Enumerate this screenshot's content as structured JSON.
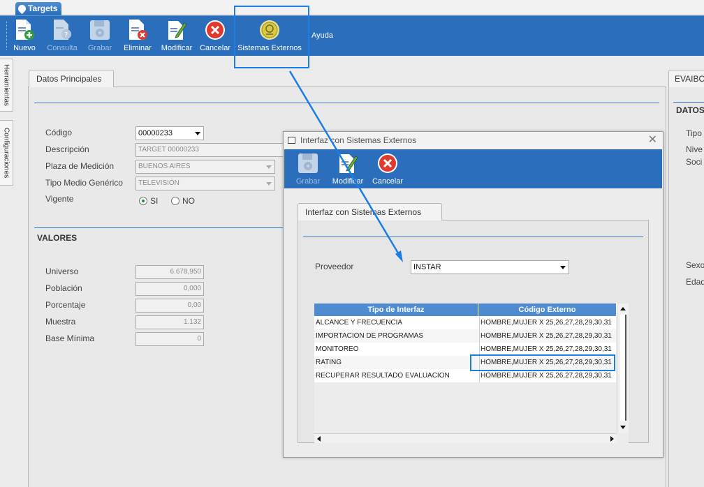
{
  "doc_tab": {
    "label": "Targets"
  },
  "ribbon": {
    "buttons": [
      {
        "id": "nuevo",
        "label": "Nuevo",
        "enabled": true,
        "icon": "document-add-icon"
      },
      {
        "id": "consulta",
        "label": "Consulta",
        "enabled": false,
        "icon": "document-query-icon"
      },
      {
        "id": "grabar",
        "label": "Grabar",
        "enabled": false,
        "icon": "floppy-disk-icon"
      },
      {
        "id": "eliminar",
        "label": "Eliminar",
        "enabled": true,
        "icon": "document-delete-icon"
      },
      {
        "id": "modificar",
        "label": "Modificar",
        "enabled": true,
        "icon": "document-edit-icon"
      },
      {
        "id": "cancelar",
        "label": "Cancelar",
        "enabled": true,
        "icon": "cancel-circle-icon"
      },
      {
        "id": "sistemas",
        "label": "Sistemas Externos",
        "enabled": true,
        "icon": "external-systems-icon"
      }
    ],
    "ayuda": "Ayuda"
  },
  "side_tabs": [
    "Herramientas",
    "Configuraciones"
  ],
  "main_tab": "Datos Principales",
  "datos": {
    "codigo": {
      "label": "Código",
      "value": "00000233"
    },
    "descripcion": {
      "label": "Descripción",
      "value": "TARGET 00000233"
    },
    "plaza": {
      "label": "Plaza de Medición",
      "value": "BUENOS AIRES"
    },
    "tipo_medio": {
      "label": "Tipo Medio Genérico",
      "value": "TELEVISIÓN"
    },
    "vigente": {
      "label": "Vigente",
      "si": "SI",
      "no": "NO",
      "selected": "SI"
    }
  },
  "valores": {
    "title": "VALORES",
    "universo": {
      "label": "Universo",
      "value": "6.678,950"
    },
    "poblacion": {
      "label": "Población",
      "value": "0,000"
    },
    "porcentaje": {
      "label": "Porcentaje",
      "value": "0,00"
    },
    "muestra": {
      "label": "Muestra",
      "value": "1.132"
    },
    "base_minima": {
      "label": "Base Mínima",
      "value": "0"
    }
  },
  "right_panel": {
    "tab": "EVAIBO",
    "section": "DATOS",
    "labels": [
      "Tipo",
      "Nive",
      "Soci",
      "Sexo",
      "Edad"
    ]
  },
  "dialog": {
    "title": "Interfaz con Sistemas Externos",
    "close": "✕",
    "buttons": [
      {
        "id": "grabar",
        "label": "Grabar",
        "enabled": false,
        "icon": "floppy-disk-icon"
      },
      {
        "id": "modificar",
        "label": "Modificar",
        "enabled": true,
        "icon": "document-edit-icon"
      },
      {
        "id": "cancelar",
        "label": "Cancelar",
        "enabled": true,
        "icon": "cancel-circle-icon"
      }
    ],
    "tab": "Interfaz con Sistemas Externos",
    "proveedor": {
      "label": "Proveedor",
      "value": "INSTAR"
    },
    "grid": {
      "columns": [
        "Tipo de Interfaz",
        "Código Externo"
      ],
      "rows": [
        [
          "ALCANCE Y FRECUENCIA",
          "HOMBRE,MUJER X 25,26,27,28,29,30,31"
        ],
        [
          "IMPORTACION DE PROGRAMAS",
          "HOMBRE,MUJER X 25,26,27,28,29,30,31"
        ],
        [
          "MONITOREO",
          "HOMBRE,MUJER X 25,26,27,28,29,30,31"
        ],
        [
          "RATING",
          "HOMBRE,MUJER X 25,26,27,28,29,30,31"
        ],
        [
          "RECUPERAR RESULTADO EVALUACION",
          "HOMBRE,MUJER X 25,26,27,28,29,30,31"
        ]
      ]
    }
  },
  "colors": {
    "ribbon": "#2b6fbc",
    "highlight": "#1a7de8",
    "grid_header": "#4e8bd0"
  }
}
